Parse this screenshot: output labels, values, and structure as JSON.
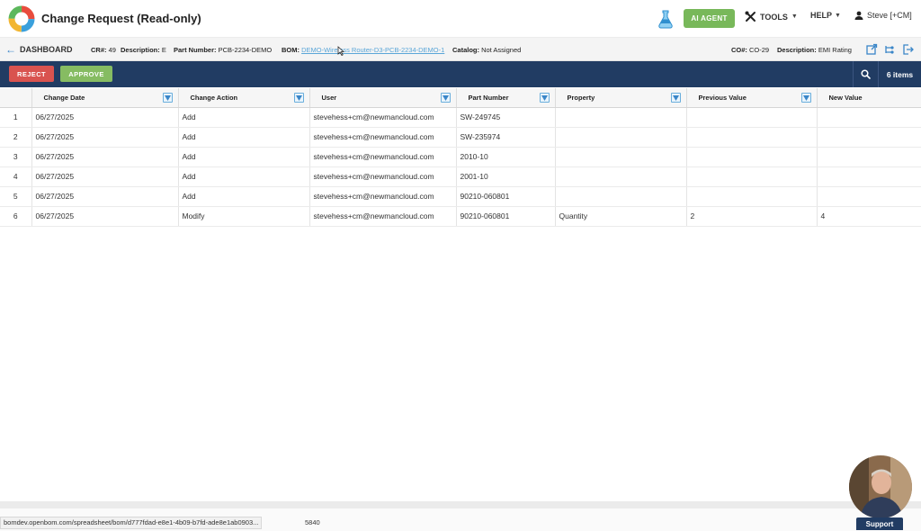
{
  "header": {
    "title": "Change Request (Read-only)",
    "ai_agent_label": "AI AGENT",
    "tools_label": "TOOLS",
    "help_label": "HELP",
    "user_label": "Steve [+CM]"
  },
  "infobar": {
    "back_label": "DASHBOARD",
    "cr_key": "CR#:",
    "cr_value": "49",
    "description_key": "Description:",
    "description_value": "E",
    "part_number_key": "Part Number:",
    "part_number_value": "PCB-2234-DEMO",
    "bom_key": "BOM:",
    "bom_value": "DEMO-Wireless Router-D3-PCB-2234-DEMO-1",
    "catalog_key": "Catalog:",
    "catalog_value": "Not Assigned",
    "co_key": "CO#:",
    "co_value": "CO-29",
    "co_description_key": "Description:",
    "co_description_value": "EMI Rating"
  },
  "actionbar": {
    "reject_label": "REJECT",
    "approve_label": "APPROVE",
    "items_count": "6 items"
  },
  "table": {
    "columns": [
      "",
      "Change Date",
      "Change Action",
      "User",
      "Part Number",
      "Property",
      "Previous Value",
      "New Value"
    ],
    "rows": [
      [
        "1",
        "06/27/2025",
        "Add",
        "stevehess+cm@newmancloud.com",
        "SW-249745",
        "",
        "",
        ""
      ],
      [
        "2",
        "06/27/2025",
        "Add",
        "stevehess+cm@newmancloud.com",
        "SW-235974",
        "",
        "",
        ""
      ],
      [
        "3",
        "06/27/2025",
        "Add",
        "stevehess+cm@newmancloud.com",
        "2010-10",
        "",
        "",
        ""
      ],
      [
        "4",
        "06/27/2025",
        "Add",
        "stevehess+cm@newmancloud.com",
        "2001-10",
        "",
        "",
        ""
      ],
      [
        "5",
        "06/27/2025",
        "Add",
        "stevehess+cm@newmancloud.com",
        "90210-060801",
        "",
        "",
        ""
      ],
      [
        "6",
        "06/27/2025",
        "Modify",
        "stevehess+cm@newmancloud.com",
        "90210-060801",
        "Quantity",
        "2",
        "4"
      ]
    ]
  },
  "footer": {
    "url_tooltip": "bomdev.openbom.com/spreadsheet/bom/d777fdad-e8e1-4b09-b7fd-ade8e1ab0903...",
    "url_tail": "5840",
    "support_label": "Support"
  },
  "colors": {
    "navy": "#213c63",
    "reject": "#d9534f",
    "approve": "#86bc62",
    "ai_agent": "#78b85a",
    "link": "#5aa6d8"
  },
  "icons": [
    "openbom-logo-icon",
    "flask-icon",
    "tools-icon",
    "user-icon",
    "back-arrow-icon",
    "cursor-icon",
    "external-link-icon",
    "tree-icon",
    "exit-icon",
    "search-icon",
    "filter-icon"
  ]
}
